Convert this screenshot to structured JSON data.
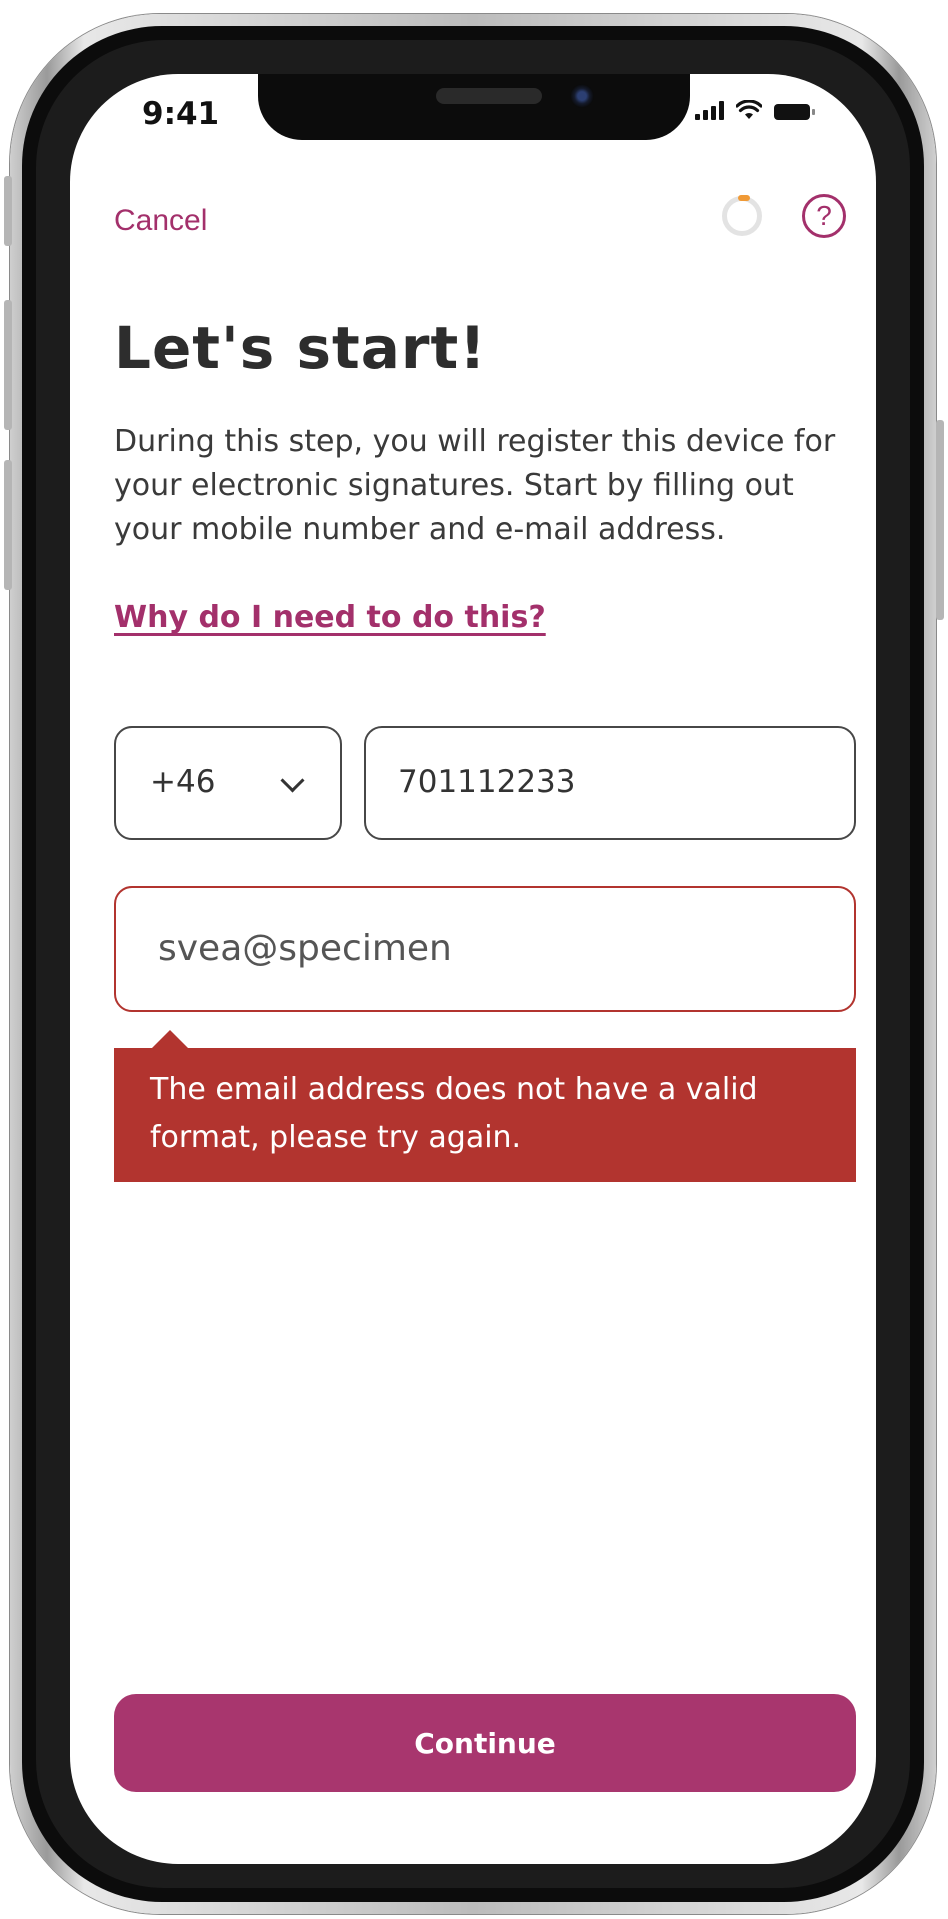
{
  "status_bar": {
    "time": "9:41"
  },
  "header": {
    "cancel_label": "Cancel",
    "help_label": "?"
  },
  "main": {
    "title": "Let's start!",
    "intro": "During this step, you will register this device for your electronic signatures. Start by filling out your mobile number and e-mail address.",
    "why_link": "Why do I need to do this?"
  },
  "form": {
    "country_code": "+46",
    "phone_number": "701112233",
    "email_value": "svea@specimen",
    "error_message": "The email address does not have a valid format, please try again."
  },
  "footer": {
    "continue_label": "Continue"
  },
  "colors": {
    "accent": "#a3306b",
    "error": "#b2342f",
    "button": "#a8366e"
  },
  "icons": [
    "loading-spinner-icon",
    "help-icon",
    "chevron-down-icon",
    "signal-icon",
    "wifi-icon",
    "battery-icon"
  ]
}
